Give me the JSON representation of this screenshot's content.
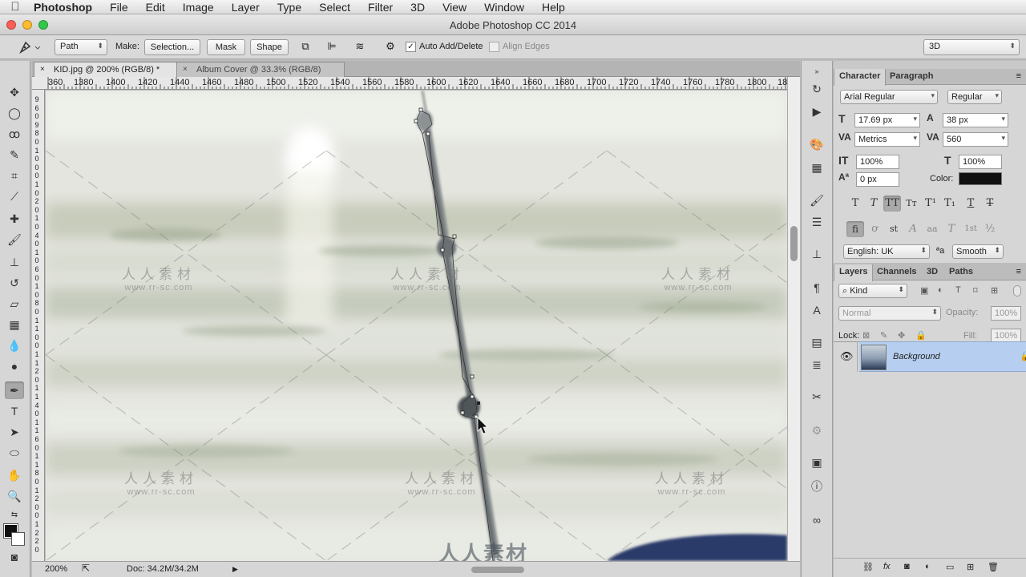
{
  "menubar": {
    "apple": "",
    "items": [
      "Photoshop",
      "File",
      "Edit",
      "Image",
      "Layer",
      "Type",
      "Select",
      "Filter",
      "3D",
      "View",
      "Window",
      "Help"
    ]
  },
  "window": {
    "title": "Adobe Photoshop CC 2014"
  },
  "options": {
    "tool_mode": "Path",
    "make_label": "Make:",
    "selection_btn": "Selection...",
    "mask_btn": "Mask",
    "shape_btn": "Shape",
    "auto_add_delete": "Auto Add/Delete",
    "auto_add_delete_checked": "✓",
    "align_edges": "Align Edges",
    "workspace": "3D"
  },
  "tabs": [
    {
      "label": "KID.jpg @ 200% (RGB/8) *",
      "close": "×"
    },
    {
      "label": "Album Cover @ 33.3% (RGB/8)",
      "close": "×"
    }
  ],
  "ruler": {
    "h_labels": [
      "360",
      "1380",
      "1400",
      "1420",
      "1440",
      "1460",
      "1480",
      "1500",
      "1520",
      "1540",
      "1560",
      "1580",
      "1600",
      "1620",
      "1640",
      "1660",
      "1680",
      "1700",
      "1720",
      "1740",
      "1760",
      "1780",
      "1800",
      "18"
    ],
    "v_labels": [
      "9",
      "6",
      "0",
      "9",
      "8",
      "0",
      "1",
      "0",
      "0",
      "0",
      "1",
      "0",
      "2",
      "0",
      "1",
      "0",
      "4",
      "0",
      "1",
      "0",
      "6",
      "0",
      "1",
      "0",
      "8",
      "0",
      "1",
      "1",
      "0",
      "0",
      "1",
      "1",
      "2",
      "0",
      "1",
      "1",
      "4",
      "0",
      "1",
      "1",
      "6",
      "0",
      "1",
      "1",
      "8",
      "0",
      "1",
      "2",
      "0",
      "0",
      "1",
      "2",
      "2",
      "0"
    ]
  },
  "watermark": {
    "cn": "人人素材",
    "url": "www.rr-sc.com",
    "logo": "人人素材"
  },
  "status": {
    "zoom": "200%",
    "doc": "Doc: 34.2M/34.2M"
  },
  "character": {
    "tabs": [
      "Character",
      "Paragraph"
    ],
    "font_family": "Arial Regular",
    "font_style": "Regular",
    "size": "17.69 px",
    "leading": "38 px",
    "kerning": "Metrics",
    "tracking": "560",
    "v_scale": "100%",
    "h_scale": "100%",
    "baseline": "0 px",
    "color_label": "Color:",
    "language": "English: UK",
    "aa_icon": "a",
    "antialias": "Smooth",
    "style_glyphs": [
      "T",
      "T",
      "TT",
      "Tт",
      "T¹",
      "T₁",
      "T",
      "T"
    ],
    "ot_glyphs": [
      "fi",
      "ơ",
      "st",
      "A",
      "aa",
      "T",
      "1st",
      "½"
    ]
  },
  "layers": {
    "tabs": [
      "Layers",
      "Channels",
      "3D",
      "Paths"
    ],
    "kind": "Kind",
    "blend_mode": "Normal",
    "opacity_label": "Opacity:",
    "opacity": "100%",
    "lock_label": "Lock:",
    "fill_label": "Fill:",
    "fill": "100%",
    "items": [
      {
        "name": "Background"
      }
    ]
  },
  "colors": {
    "accent_selection": "#b6cff0",
    "foreground": "#111111",
    "background": "#ffffff"
  }
}
